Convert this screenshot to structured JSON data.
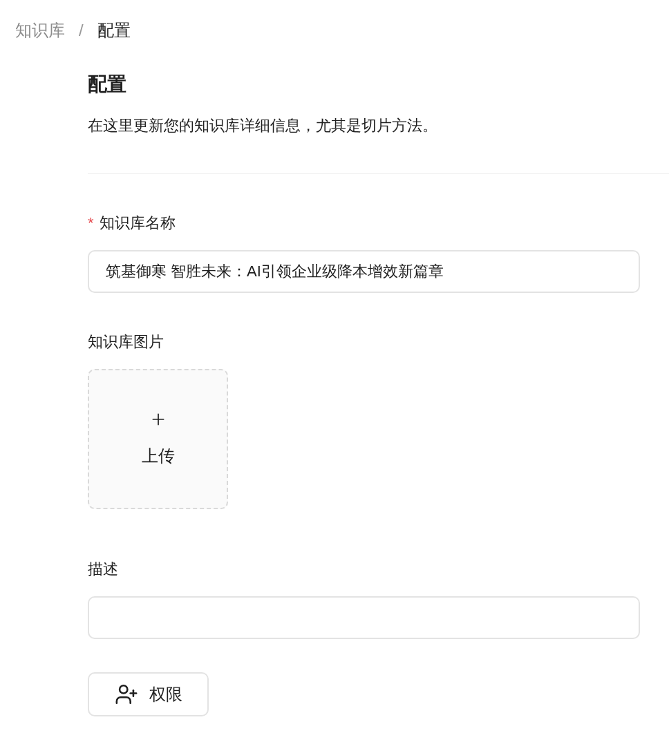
{
  "breadcrumb": [
    {
      "label": "知识库",
      "selected": false
    },
    {
      "label": "配置",
      "selected": true
    }
  ],
  "breadcrumb_separator": "/",
  "title": "配置",
  "subtitle": "在这里更新您的知识库详细信息，尤其是切片方法。",
  "fields": [
    {
      "kind": "text",
      "label": "知识库名称",
      "required": true,
      "value": "筑基御寒 智胜未来：AI引领企业级降本增效新篇章"
    },
    {
      "kind": "upload",
      "label": "知识库图片",
      "required": false,
      "upload_label": "上传"
    },
    {
      "kind": "text",
      "label": "描述",
      "required": false
    }
  ],
  "required_marker": "*",
  "permission_button": "权限"
}
